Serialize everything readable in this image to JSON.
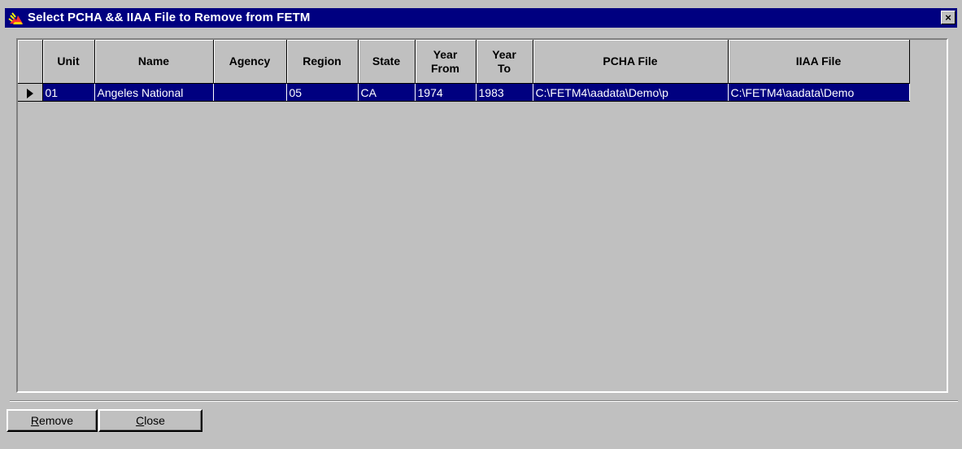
{
  "window": {
    "title": "Select PCHA && IIAA File to Remove from FETM",
    "close_label": "×",
    "icon": "fire-icon"
  },
  "grid": {
    "columns": [
      {
        "key": "indicator",
        "label": ""
      },
      {
        "key": "unit",
        "label": "Unit"
      },
      {
        "key": "name",
        "label": "Name"
      },
      {
        "key": "agency",
        "label": "Agency"
      },
      {
        "key": "region",
        "label": "Region"
      },
      {
        "key": "state",
        "label": "State"
      },
      {
        "key": "year_from",
        "label": "Year\nFrom"
      },
      {
        "key": "year_to",
        "label": "Year\nTo"
      },
      {
        "key": "pcha_file",
        "label": "PCHA File"
      },
      {
        "key": "iiaa_file",
        "label": "IIAA File"
      }
    ],
    "rows": [
      {
        "selected": true,
        "unit": "01",
        "name": "Angeles National",
        "agency": "",
        "region": "05",
        "state": "CA",
        "year_from": "1974",
        "year_to": "1983",
        "pcha_file": "C:\\FETM4\\aadata\\Demo\\p",
        "iiaa_file": "C:\\FETM4\\aadata\\Demo"
      }
    ]
  },
  "buttons": {
    "remove": {
      "accel": "R",
      "rest": "emove"
    },
    "close": {
      "accel": "C",
      "rest": "lose"
    }
  },
  "colors": {
    "titlebar": "#000080",
    "selection": "#000080",
    "face": "#c0c0c0"
  }
}
